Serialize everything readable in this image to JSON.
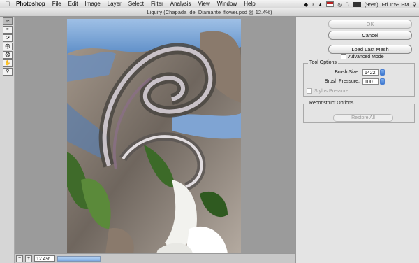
{
  "menubar": {
    "app": "Photoshop",
    "items": [
      "File",
      "Edit",
      "Image",
      "Layer",
      "Select",
      "Filter",
      "Analysis",
      "View",
      "Window",
      "Help"
    ],
    "battery": "(95%)",
    "clock": "Fri 1:59 PM"
  },
  "window": {
    "title": "Liquify (Chapada_de_Diamante_flower.psd @ 12.4%)"
  },
  "zoom": {
    "value": "12.4%"
  },
  "panel": {
    "ok_label": "OK",
    "cancel_label": "Cancel",
    "load_mesh_label": "Load Last Mesh",
    "advanced_mode_label": "Advanced Mode",
    "tool_options": {
      "title": "Tool Options",
      "brush_size_label": "Brush Size:",
      "brush_size_value": "1422",
      "brush_pressure_label": "Brush Pressure:",
      "brush_pressure_value": "100",
      "stylus_label": "Stylus Pressure"
    },
    "reconstruct": {
      "title": "Reconstruct Options",
      "restore_label": "Restore All"
    }
  },
  "tools": [
    "forward-warp",
    "reconstruct",
    "twirl",
    "pucker",
    "bloat",
    "hand",
    "zoom"
  ]
}
